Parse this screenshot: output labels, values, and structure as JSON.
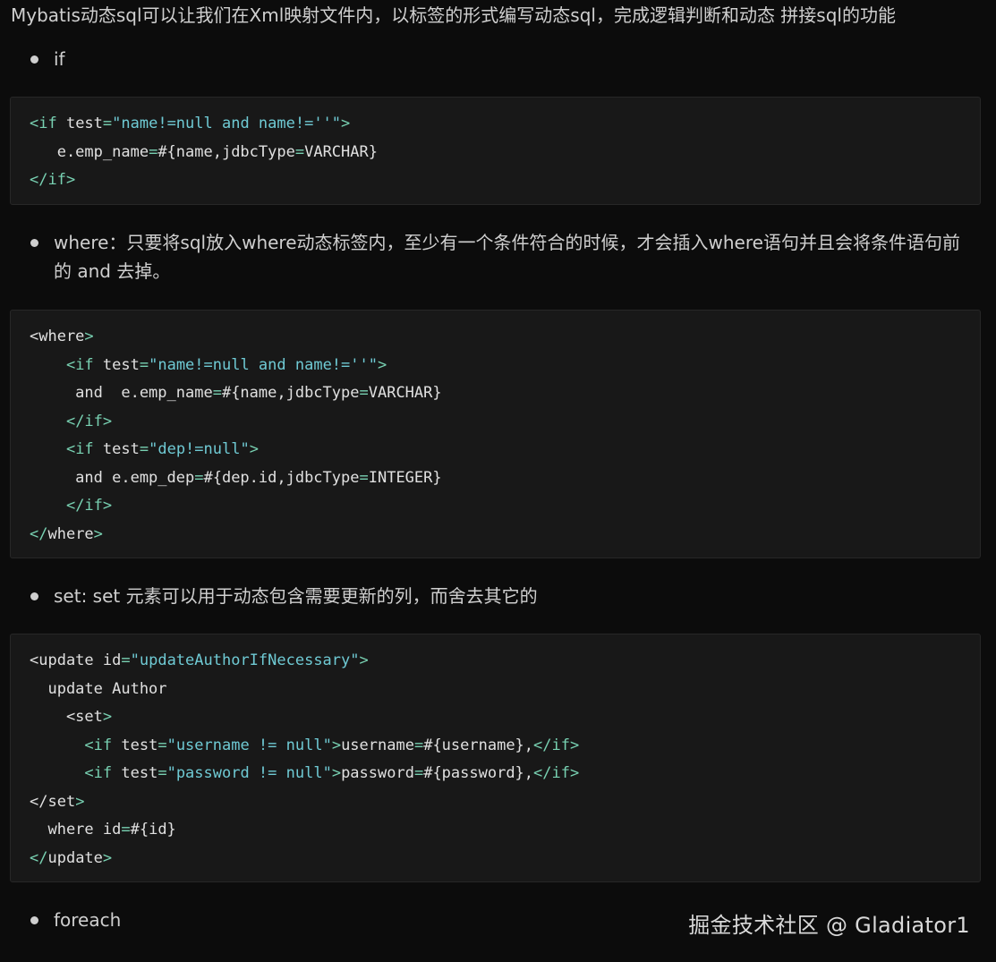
{
  "intro": "Mybatis动态sql可以让我们在Xml映射文件内，以标签的形式编写动态sql，完成逻辑判断和动态 拼接sql的功能",
  "bullets": [
    {
      "text": "if"
    },
    {
      "text": "where：只要将sql放入where动态标签内，至少有一个条件符合的时候，才会插入where语句并且会将条件语句前的 and 去掉。"
    },
    {
      "text": "set: set 元素可以用于动态包含需要更新的列，而舍去其它的"
    },
    {
      "text": "foreach"
    }
  ],
  "code_blocks": [
    {
      "lines": [
        [
          {
            "t": "<if",
            "c": "tag"
          },
          {
            "t": " test",
            "c": "txt"
          },
          {
            "t": "=",
            "c": "tag"
          },
          {
            "t": "\"name!=null and name!=''\"",
            "c": "str"
          },
          {
            "t": ">",
            "c": "tag"
          }
        ],
        [
          {
            "t": "   e.emp_name",
            "c": "txt"
          },
          {
            "t": "=",
            "c": "tag"
          },
          {
            "t": "#{name,jdbcType",
            "c": "txt"
          },
          {
            "t": "=",
            "c": "tag"
          },
          {
            "t": "VARCHAR}",
            "c": "txt"
          }
        ],
        [
          {
            "t": "</if>",
            "c": "tag"
          }
        ]
      ]
    },
    {
      "lines": [
        [
          {
            "t": "<where",
            "c": "txt"
          },
          {
            "t": ">",
            "c": "tag"
          }
        ],
        [
          {
            "t": "    ",
            "c": "txt"
          },
          {
            "t": "<if",
            "c": "tag"
          },
          {
            "t": " test",
            "c": "txt"
          },
          {
            "t": "=",
            "c": "tag"
          },
          {
            "t": "\"name!=null and name!=''\"",
            "c": "str"
          },
          {
            "t": ">",
            "c": "tag"
          }
        ],
        [
          {
            "t": "     and  e.emp_name",
            "c": "txt"
          },
          {
            "t": "=",
            "c": "tag"
          },
          {
            "t": "#{name,jdbcType",
            "c": "txt"
          },
          {
            "t": "=",
            "c": "tag"
          },
          {
            "t": "VARCHAR}",
            "c": "txt"
          }
        ],
        [
          {
            "t": "    ",
            "c": "txt"
          },
          {
            "t": "</if>",
            "c": "tag"
          }
        ],
        [
          {
            "t": "    ",
            "c": "txt"
          },
          {
            "t": "<if",
            "c": "tag"
          },
          {
            "t": " test",
            "c": "txt"
          },
          {
            "t": "=",
            "c": "tag"
          },
          {
            "t": "\"dep!=null\"",
            "c": "str"
          },
          {
            "t": ">",
            "c": "tag"
          }
        ],
        [
          {
            "t": "     and e.emp_dep",
            "c": "txt"
          },
          {
            "t": "=",
            "c": "tag"
          },
          {
            "t": "#{dep.id,jdbcType",
            "c": "txt"
          },
          {
            "t": "=",
            "c": "tag"
          },
          {
            "t": "INTEGER}",
            "c": "txt"
          }
        ],
        [
          {
            "t": "    ",
            "c": "txt"
          },
          {
            "t": "</if>",
            "c": "tag"
          }
        ],
        [
          {
            "t": "</",
            "c": "tag"
          },
          {
            "t": "where",
            "c": "txt"
          },
          {
            "t": ">",
            "c": "tag"
          }
        ]
      ]
    },
    {
      "lines": [
        [
          {
            "t": "<update",
            "c": "txt"
          },
          {
            "t": " id",
            "c": "txt"
          },
          {
            "t": "=",
            "c": "tag"
          },
          {
            "t": "\"updateAuthorIfNecessary\"",
            "c": "str"
          },
          {
            "t": ">",
            "c": "tag"
          }
        ],
        [
          {
            "t": "  update Author",
            "c": "txt"
          }
        ],
        [
          {
            "t": "    <set",
            "c": "txt"
          },
          {
            "t": ">",
            "c": "tag"
          }
        ],
        [
          {
            "t": "      ",
            "c": "txt"
          },
          {
            "t": "<if",
            "c": "tag"
          },
          {
            "t": " test",
            "c": "txt"
          },
          {
            "t": "=",
            "c": "tag"
          },
          {
            "t": "\"username != null\"",
            "c": "str"
          },
          {
            "t": ">",
            "c": "tag"
          },
          {
            "t": "username",
            "c": "txt"
          },
          {
            "t": "=",
            "c": "tag"
          },
          {
            "t": "#{username},",
            "c": "txt"
          },
          {
            "t": "</if>",
            "c": "tag"
          }
        ],
        [
          {
            "t": "      ",
            "c": "txt"
          },
          {
            "t": "<if",
            "c": "tag"
          },
          {
            "t": " test",
            "c": "txt"
          },
          {
            "t": "=",
            "c": "tag"
          },
          {
            "t": "\"password != null\"",
            "c": "str"
          },
          {
            "t": ">",
            "c": "tag"
          },
          {
            "t": "password",
            "c": "txt"
          },
          {
            "t": "=",
            "c": "tag"
          },
          {
            "t": "#{password},",
            "c": "txt"
          },
          {
            "t": "</if>",
            "c": "tag"
          }
        ],
        [
          {
            "t": "</set",
            "c": "txt"
          },
          {
            "t": ">",
            "c": "tag"
          }
        ],
        [
          {
            "t": "  where id",
            "c": "txt"
          },
          {
            "t": "=",
            "c": "tag"
          },
          {
            "t": "#{id}",
            "c": "txt"
          }
        ],
        [
          {
            "t": "</",
            "c": "tag"
          },
          {
            "t": "update",
            "c": "txt"
          },
          {
            "t": ">",
            "c": "tag"
          }
        ]
      ]
    }
  ],
  "watermark": "掘金技术社区 @ Gladiator1",
  "colors": {
    "background": "#0c0c0c",
    "code_background": "#181818",
    "tag": "#78d1b2",
    "string": "#6fcad4",
    "text": "#e0e0e0"
  }
}
